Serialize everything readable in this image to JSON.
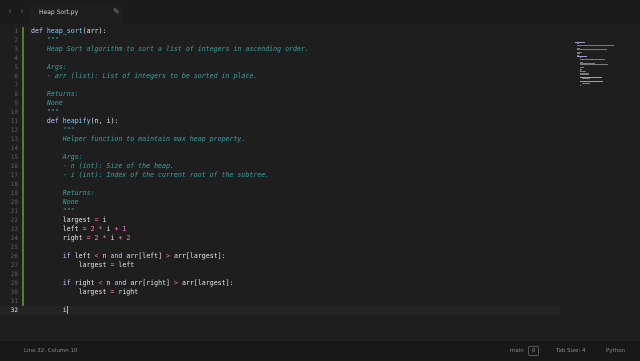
{
  "tab": {
    "title": "Heap Sort.py",
    "icon": "pencil-icon"
  },
  "nav": {
    "back": "‹",
    "forward": "›"
  },
  "editor": {
    "current_line": 32,
    "lines": [
      {
        "n": "1",
        "t": "def heap_sort(arr):"
      },
      {
        "n": "2",
        "t": "    \"\"\""
      },
      {
        "n": "3",
        "t": "    Heap Sort algorithm to sort a list of integers in ascending order."
      },
      {
        "n": "4",
        "t": ""
      },
      {
        "n": "5",
        "t": "    Args:"
      },
      {
        "n": "6",
        "t": "    - arr (list): List of integers to be sorted in place."
      },
      {
        "n": "7",
        "t": ""
      },
      {
        "n": "8",
        "t": "    Returns:"
      },
      {
        "n": "9",
        "t": "    None"
      },
      {
        "n": "10",
        "t": "    \"\"\""
      },
      {
        "n": "11",
        "t": "    def heapify(n, i):"
      },
      {
        "n": "12",
        "t": "        \"\"\""
      },
      {
        "n": "13",
        "t": "        Helper function to maintain max heap property."
      },
      {
        "n": "14",
        "t": ""
      },
      {
        "n": "15",
        "t": "        Args:"
      },
      {
        "n": "16",
        "t": "        - n (int): Size of the heap."
      },
      {
        "n": "17",
        "t": "        - i (int): Index of the current root of the subtree."
      },
      {
        "n": "18",
        "t": ""
      },
      {
        "n": "19",
        "t": "        Returns:"
      },
      {
        "n": "20",
        "t": "        None"
      },
      {
        "n": "21",
        "t": "        \"\"\""
      },
      {
        "n": "22",
        "t": "        largest = i"
      },
      {
        "n": "23",
        "t": "        left = 2 * i + 1"
      },
      {
        "n": "24",
        "t": "        right = 2 * i + 2"
      },
      {
        "n": "25",
        "t": ""
      },
      {
        "n": "26",
        "t": "        if left < n and arr[left] > arr[largest]:"
      },
      {
        "n": "27",
        "t": "            largest = left"
      },
      {
        "n": "28",
        "t": ""
      },
      {
        "n": "29",
        "t": "        if right < n and arr[right] > arr[largest]:"
      },
      {
        "n": "30",
        "t": "            largest = right"
      },
      {
        "n": "31",
        "t": ""
      },
      {
        "n": "32",
        "t": "        i"
      }
    ]
  },
  "status": {
    "position": "Line 32, Column 10",
    "branch": "main",
    "branch_badge": "0",
    "tab_size": "Tab Size: 4",
    "language": "Python"
  }
}
